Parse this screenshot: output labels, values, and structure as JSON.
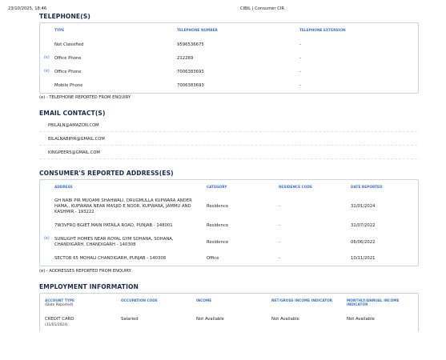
{
  "header": {
    "datetime": "23/10/2025, 18:46",
    "doc_title": "CIBIL | Consumer CIR"
  },
  "telephones": {
    "section_title": "TELEPHONE(S)",
    "columns": [
      "TYPE",
      "TELEPHONE NUMBER",
      "TELEPHONE EXTENSION"
    ],
    "rows": [
      {
        "mark": "",
        "type": "Not Classified",
        "number": "9596536675",
        "extension": "-"
      },
      {
        "mark": "(e)",
        "type": "Office Phone",
        "number": "212269",
        "extension": "-"
      },
      {
        "mark": "(e)",
        "type": "Office Phone",
        "number": "7006383693",
        "extension": "-"
      },
      {
        "mark": "",
        "type": "Mobile Phone",
        "number": "7006383693",
        "extension": "-"
      }
    ],
    "footnote": "(e) - TELEPHONE REPORTED FROM ENQUIRY"
  },
  "emails": {
    "section_title": "EMAIL CONTACT(S)",
    "items": [
      "PBILALN@AMAZON.COM",
      "BILALNABIPIR@GMAIL.COM",
      "KINGPEER5@GMAIL.COM"
    ]
  },
  "addresses": {
    "section_title": "CONSUMER'S REPORTED ADDRESS(ES)",
    "columns": [
      "ADDRESS",
      "CATEGORY",
      "RESIDENCE CODE",
      "DATE REPORTED"
    ],
    "rows": [
      {
        "mark": "",
        "address": "GH NABI PIR MUQAMI SHAHWALI, DRUGMULLA KUPWARA ANDER HAMA,, KUPWARA NEAR MASJID E NOOR, KUPWARA, JAMMU AND KASHMIR - 193222",
        "category": "Residence",
        "residence_code": "-",
        "date": "31/01/2024"
      },
      {
        "mark": "",
        "address": "7W3VFRQ BGIET MAIN PATAILA ROAD, PUNJAB - 148001",
        "category": "Residence",
        "residence_code": "-",
        "date": "31/07/2022"
      },
      {
        "mark": "(e)",
        "address": "SUNLIGHT HOMES NEAR ROYAL GYM SOHANA, SOHANA, CHANDIGARH, CHANDIGARH - 140308",
        "category": "Residence",
        "residence_code": "-",
        "date": "06/06/2022"
      },
      {
        "mark": "",
        "address": "SECTOR 65 MOHALI CHANDIGARH, PUNJAB - 140308",
        "category": "Office",
        "residence_code": "-",
        "date": "10/11/2021"
      }
    ],
    "footnote": "(e) - ADDRESSES REPORTED FROM ENQUIRY"
  },
  "employment": {
    "section_title": "EMPLOYMENT INFORMATION",
    "columns": {
      "account_type": "ACCOUNT TYPE",
      "account_type_sub": "(Date Reported)",
      "occupation": "OCCUPATION CODE",
      "income": "INCOME",
      "net_gross": "NET/GROSS INCOME INDICATOR",
      "monthly_annual": "MONTHLY/ANNUAL INCOME INDICATOR"
    },
    "row": {
      "account_type": "CREDIT CARD",
      "date_reported": "(31/01/2024)",
      "occupation": "Salaried",
      "income": "Not Available",
      "net_gross": "Not Available",
      "monthly_annual": "Not Available"
    }
  }
}
